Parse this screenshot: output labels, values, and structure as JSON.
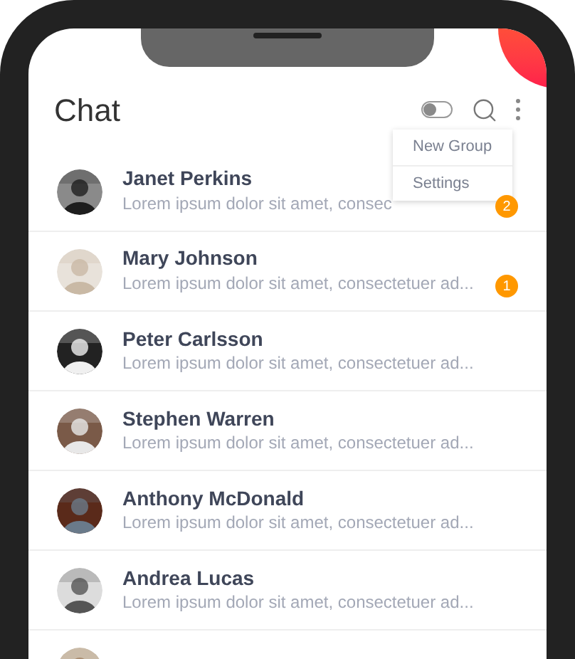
{
  "header": {
    "title": "Chat"
  },
  "menu": {
    "items": [
      "New Group",
      "Settings"
    ]
  },
  "chats": [
    {
      "name": "Janet Perkins",
      "message": "Lorem ipsum dolor sit amet, consec",
      "badge": "2"
    },
    {
      "name": "Mary Johnson",
      "message": "Lorem ipsum dolor sit amet, consectetuer ad...",
      "badge": "1"
    },
    {
      "name": "Peter Carlsson",
      "message": "Lorem ipsum dolor sit amet, consectetuer ad..."
    },
    {
      "name": "Stephen Warren",
      "message": "Lorem ipsum dolor sit amet, consectetuer ad..."
    },
    {
      "name": "Anthony McDonald",
      "message": "Lorem ipsum dolor sit amet, consectetuer ad..."
    },
    {
      "name": "Andrea Lucas",
      "message": "Lorem ipsum dolor sit amet, consectetuer ad..."
    }
  ]
}
